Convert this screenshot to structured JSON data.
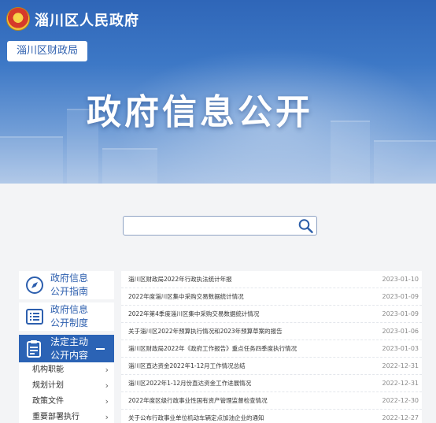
{
  "header": {
    "site_title": "淄川区人民政府",
    "department_button": "淄川区财政局",
    "banner_title": "政府信息公开",
    "emblem_icon": "national-emblem-icon"
  },
  "search": {
    "placeholder": "",
    "value": "",
    "icon": "search-icon"
  },
  "sidebar": {
    "items": [
      {
        "label_line1": "政府信息",
        "label_line2": "公开指南",
        "icon": "compass-icon",
        "active": false
      },
      {
        "label_line1": "政府信息",
        "label_line2": "公开制度",
        "icon": "document-list-icon",
        "active": false
      },
      {
        "label_line1": "法定主动",
        "label_line2": "公开内容",
        "icon": "clipboard-icon",
        "active": true
      }
    ],
    "sub_items": [
      {
        "label": "机构职能"
      },
      {
        "label": "规划计划"
      },
      {
        "label": "政策文件"
      },
      {
        "label": "重要部署执行"
      }
    ]
  },
  "articles": [
    {
      "title": "淄川区财政局2022年行政执法统计年报",
      "date": "2023-01-10"
    },
    {
      "title": "2022年度淄川区集中采购交易数据统计情况",
      "date": "2023-01-09"
    },
    {
      "title": "2022年第4季度淄川区集中采购交易数据统计情况",
      "date": "2023-01-09"
    },
    {
      "title": "关于淄川区2022年预算执行情况和2023年预算草案的报告",
      "date": "2023-01-06"
    },
    {
      "title": "淄川区财政局2022年《政府工作报告》重点任务四季度执行情况",
      "date": "2023-01-03"
    },
    {
      "title": "淄川区直达资金2022年1-12月工作情况总结",
      "date": "2022-12-31"
    },
    {
      "title": "淄川区2022年1-12月份直达资金工作进展情况",
      "date": "2022-12-31"
    },
    {
      "title": "2022年度区级行政事业性国有资产管理监督检查情况",
      "date": "2022-12-30"
    },
    {
      "title": "关于公布行政事业单位机动车辆定点加油企业的通知",
      "date": "2022-12-27"
    }
  ],
  "colors": {
    "primary": "#2b63b5",
    "banner_top": "#2f66b8",
    "accent_text": "#2d5fae"
  }
}
